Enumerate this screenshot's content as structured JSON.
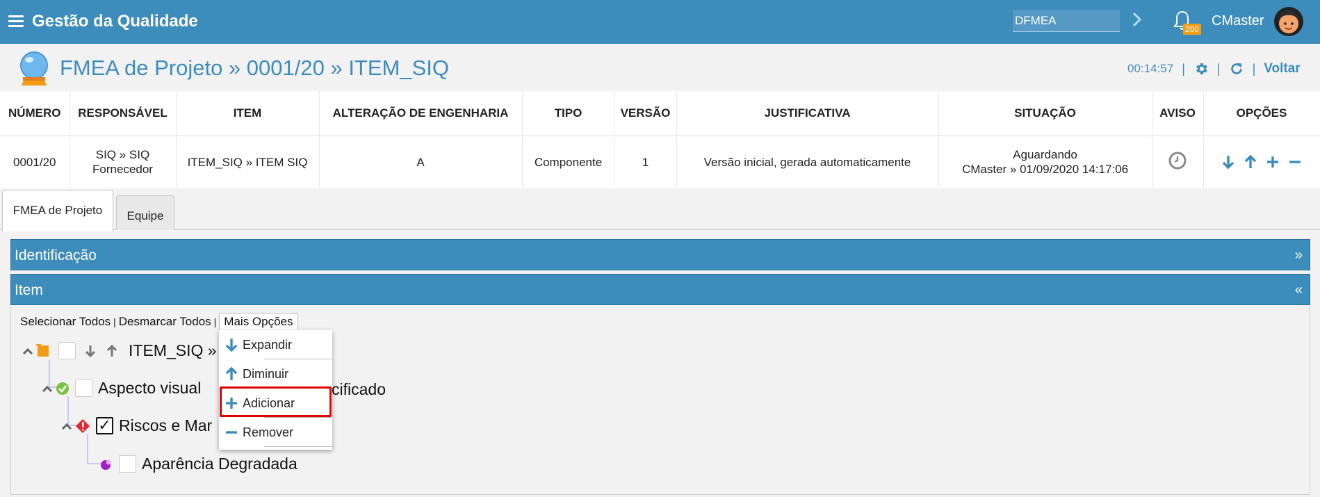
{
  "topbar": {
    "app_title": "Gestão da Qualidade",
    "search_value": "DFMEA",
    "notification_count": "200",
    "user_name": "CMaster",
    "bg_color": "#3c8dbc"
  },
  "header": {
    "title": "FMEA de Projeto » 0001/20 » ITEM_SIQ",
    "timer": "00:14:57",
    "back_label": "Voltar"
  },
  "table": {
    "headers": [
      "NÚMERO",
      "RESPONSÁVEL",
      "ITEM",
      "ALTERAÇÃO DE ENGENHARIA",
      "TIPO",
      "VERSÃO",
      "JUSTIFICATIVA",
      "SITUAÇÃO",
      "AVISO",
      "OPÇÕES"
    ],
    "row": {
      "numero": "0001/20",
      "responsavel_1": "SIQ » SIQ",
      "responsavel_2": "Fornecedor",
      "item": "ITEM_SIQ » ITEM SIQ",
      "alteracao": "A",
      "tipo": "Componente",
      "versao": "1",
      "justificativa": "Versão inicial, gerada automaticamente",
      "situacao_1": "Aguardando",
      "situacao_2": "CMaster » 01/09/2020 14:17:06"
    }
  },
  "tabs": [
    {
      "label": "FMEA de Projeto",
      "active": true
    },
    {
      "label": "Equipe",
      "active": false
    }
  ],
  "panels": {
    "identificacao": {
      "title": "Identificação",
      "arrow": "»"
    },
    "item": {
      "title": "Item",
      "arrow": "«"
    }
  },
  "tree_actions": {
    "select_all": "Selecionar Todos",
    "deselect_all": "Desmarcar Todos",
    "more_options": "Mais Opções"
  },
  "tree": [
    {
      "label": "ITEM_SIQ »",
      "icon": "item-orange-square-icon",
      "checked": false
    },
    {
      "label": "Aspecto visual",
      "label_tail": "cificado",
      "icon": "green-check-icon",
      "checked": false
    },
    {
      "label": "Riscos e Mar",
      "icon": "red-warning-diamond-icon",
      "checked": true
    },
    {
      "label": "Aparência Degradada",
      "icon": "purple-dot-icon",
      "checked": false
    }
  ],
  "context_menu": {
    "items": [
      {
        "label": "Expandir",
        "icon": "arrow-down-icon"
      },
      {
        "label": "Diminuir",
        "icon": "arrow-up-icon"
      },
      {
        "label": "Adicionar",
        "icon": "plus-icon"
      },
      {
        "label": "Remover",
        "icon": "minus-icon"
      }
    ],
    "highlighted": "Adicionar"
  }
}
